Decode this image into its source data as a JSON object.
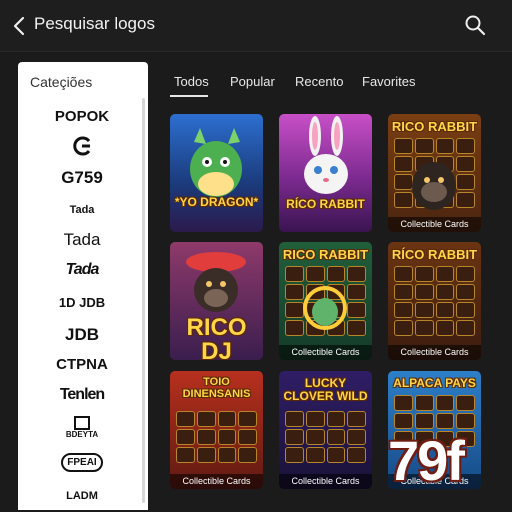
{
  "header": {
    "title": "Pesquisar logos",
    "back_icon": "chevron-left-icon",
    "search_icon": "search-icon"
  },
  "sidebar": {
    "heading": "Cateçiões",
    "logos": [
      {
        "label": "POPOK"
      },
      {
        "label": "G"
      },
      {
        "label": "G759"
      },
      {
        "label": "Tada"
      },
      {
        "label": "Tada"
      },
      {
        "label": "Tada"
      },
      {
        "label": "1D JDB"
      },
      {
        "label": "JDB"
      },
      {
        "label": "CTPNA"
      },
      {
        "label": "Tenlen"
      },
      {
        "label": "BDEYTA"
      },
      {
        "label": "FPEAI"
      },
      {
        "label": "LADM"
      }
    ]
  },
  "tabs": [
    {
      "label": "Todos",
      "active": true
    },
    {
      "label": "Popular",
      "active": false
    },
    {
      "label": "Recento",
      "active": false
    },
    {
      "label": "Favorites",
      "active": false
    }
  ],
  "tiles": [
    {
      "title": "*YO DRAGON*",
      "subtitle": ""
    },
    {
      "title": "RÍCO RABBIT",
      "subtitle": ""
    },
    {
      "title": "RICO RABBIT",
      "subtitle": "Collectible Cards"
    },
    {
      "title": "RICO DJ",
      "subtitle": ""
    },
    {
      "title": "RICO RABBIT",
      "subtitle": "Collectible Cards"
    },
    {
      "title": "RÍCO RABBIT",
      "subtitle": "Collectible Cards"
    },
    {
      "title": "TOIO DINENSANIS",
      "subtitle": "Collectible Cards"
    },
    {
      "title": "LUCKY CLOVER WILD",
      "subtitle": "Collectible Cards"
    },
    {
      "title": "ALPACA PAYS",
      "subtitle": "Collectible Cards"
    }
  ],
  "watermark": "79f",
  "colors": {
    "background": "#1b1b1b",
    "sidebar": "#ffffff",
    "accent": "#ffd54a"
  }
}
